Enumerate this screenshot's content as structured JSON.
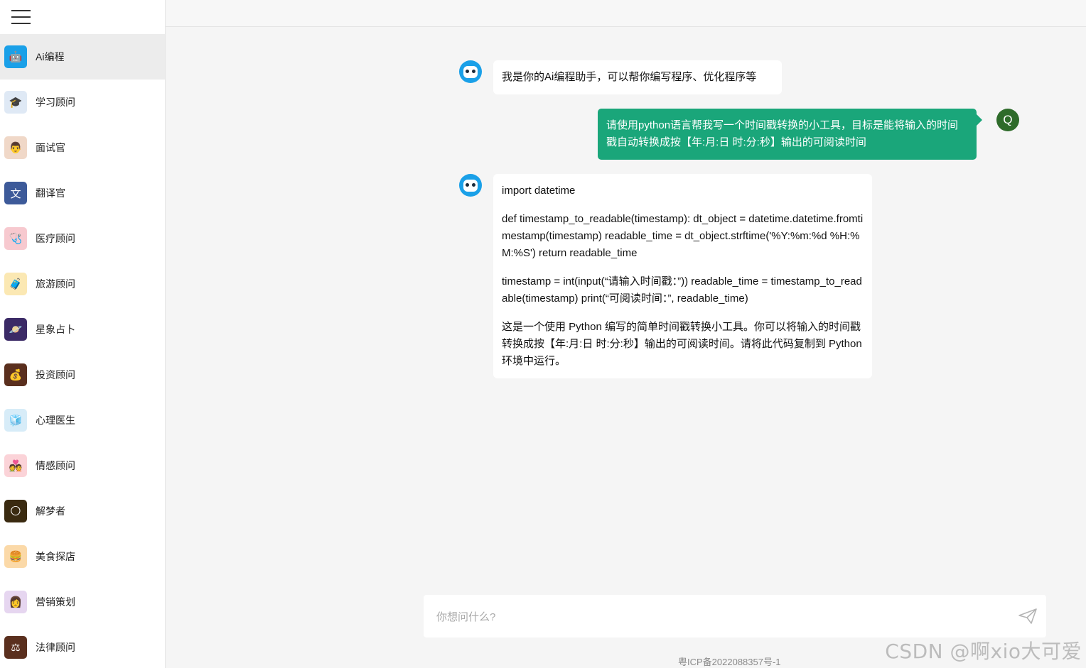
{
  "sidebar": {
    "items": [
      {
        "label": "Ai编程",
        "icon": "robot-icon",
        "color": "#1aa0e8",
        "glyph": "🤖",
        "active": true
      },
      {
        "label": "学习顾问",
        "icon": "graduation-cap-icon",
        "color": "#dfe9f5",
        "glyph": "🎓"
      },
      {
        "label": "面试官",
        "icon": "interviewer-icon",
        "color": "#f0d8c8",
        "glyph": "👨"
      },
      {
        "label": "翻译官",
        "icon": "translate-icon",
        "color": "#3d5a99",
        "glyph": "文"
      },
      {
        "label": "医疗顾问",
        "icon": "medical-icon",
        "color": "#f7c9cf",
        "glyph": "🩺"
      },
      {
        "label": "旅游顾问",
        "icon": "luggage-icon",
        "color": "#fbe8b3",
        "glyph": "🧳"
      },
      {
        "label": "星象占卜",
        "icon": "planet-icon",
        "color": "#3b2a66",
        "glyph": "🪐"
      },
      {
        "label": "投资顾问",
        "icon": "coins-icon",
        "color": "#5a2f1e",
        "glyph": "💰"
      },
      {
        "label": "心理医生",
        "icon": "heart-box-icon",
        "color": "#d7ecf8",
        "glyph": "🧊"
      },
      {
        "label": "情感顾问",
        "icon": "couple-icon",
        "color": "#fbd3d8",
        "glyph": "💑"
      },
      {
        "label": "解梦者",
        "icon": "moon-icon",
        "color": "#3a2a10",
        "glyph": "🌕"
      },
      {
        "label": "美食探店",
        "icon": "burger-icon",
        "color": "#fbd9a8",
        "glyph": "🍔"
      },
      {
        "label": "营销策划",
        "icon": "marketer-icon",
        "color": "#e6d6f0",
        "glyph": "👩"
      },
      {
        "label": "法律顾问",
        "icon": "law-icon",
        "color": "#5a2f1e",
        "glyph": "⚖"
      }
    ]
  },
  "chat": {
    "greeting": "我是你的Ai编程助手，可以帮你编写程序、优化程序等",
    "user_initial": "Q",
    "user_message": "请使用python语言帮我写一个时间戳转换的小工具，目标是能将输入的时间戳自动转换成按【年:月:日 时:分:秒】输出的可阅读时间",
    "reply_paragraphs": [
      "import datetime",
      "def timestamp_to_readable(timestamp): dt_object = datetime.datetime.fromtimestamp(timestamp) readable_time = dt_object.strftime('%Y:%m:%d %H:%M:%S') return readable_time",
      "timestamp = int(input(“请输入时间戳：”)) readable_time = timestamp_to_readable(timestamp) print(“可阅读时间：”, readable_time)",
      "这是一个使用 Python 编写的简单时间戳转换小工具。你可以将输入的时间戳转换成按【年:月:日 时:分:秒】输出的可阅读时间。请将此代码复制到 Python 环境中运行。"
    ]
  },
  "input": {
    "placeholder": "你想问什么?"
  },
  "footer": {
    "icp": "粤ICP备2022088357号-1"
  },
  "watermark": "CSDN @啊xio大可爱"
}
